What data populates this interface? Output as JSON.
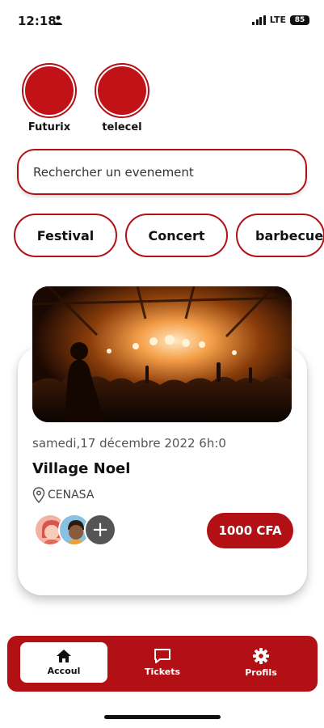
{
  "status_bar": {
    "time": "12:18",
    "network": "LTE",
    "battery": "85"
  },
  "stories": [
    {
      "label": "Futurix"
    },
    {
      "label": "telecel"
    }
  ],
  "search": {
    "placeholder": "Rechercher un evenement"
  },
  "categories": [
    {
      "label": "Festival"
    },
    {
      "label": "Concert"
    },
    {
      "label": "barbecue"
    }
  ],
  "event": {
    "date": "samedi,17 décembre 2022  6h:0",
    "title": "Village Noel",
    "location": "CENASA",
    "price": "1000 CFA",
    "add_symbol": "+"
  },
  "nav": {
    "home": "Accoul",
    "tickets": "Tickets",
    "profils": "Profils"
  },
  "colors": {
    "accent": "#b31015",
    "story_fill": "#c01217"
  },
  "icons": {
    "person": "person-icon",
    "signal": "signal-icon",
    "location": "location-pin-icon",
    "home": "home-icon",
    "tickets": "message-icon",
    "profils": "gear-icon"
  }
}
